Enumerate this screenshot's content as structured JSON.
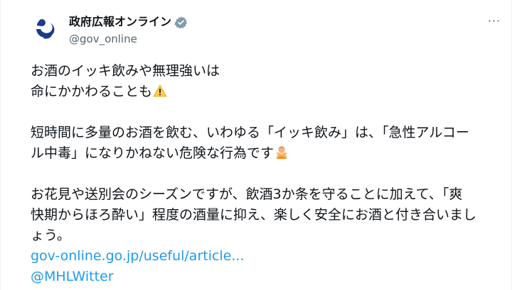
{
  "author": {
    "display_name": "政府広報オンライン",
    "handle": "@gov_online",
    "avatar_icon": "government-logo-icon",
    "verified_icon": "verified-badge-icon",
    "verified_color": "#829aab"
  },
  "more_label": "···",
  "post": {
    "line1": "お酒のイッキ飲みや無理強いは",
    "line2": "命にかかわることも",
    "line2_emoji": "warning-icon",
    "para2_line1": "短時間に多量のお酒を飲む、いわゆる「イッキ飲み」は、「急性アルコー",
    "para2_line2": "ル中毒」になりかねない危険な行為です",
    "para2_emoji": "person-gesturing-no-icon",
    "para3_line1": "お花見や送別会のシーズンですが、飲酒3か条を守ることに加えて、「爽",
    "para3_line2": "快期からほろ酔い」程度の酒量に抑え、楽しく安全にお酒と付き合いまし",
    "para3_line3": "ょう。",
    "link_url": "gov-online.go.jp/useful/article...",
    "mention": "@MHLWitter"
  },
  "colors": {
    "text": "#0f1419",
    "secondary": "#536471",
    "link": "#1d9bf0",
    "logo": "#1b3a8c"
  }
}
